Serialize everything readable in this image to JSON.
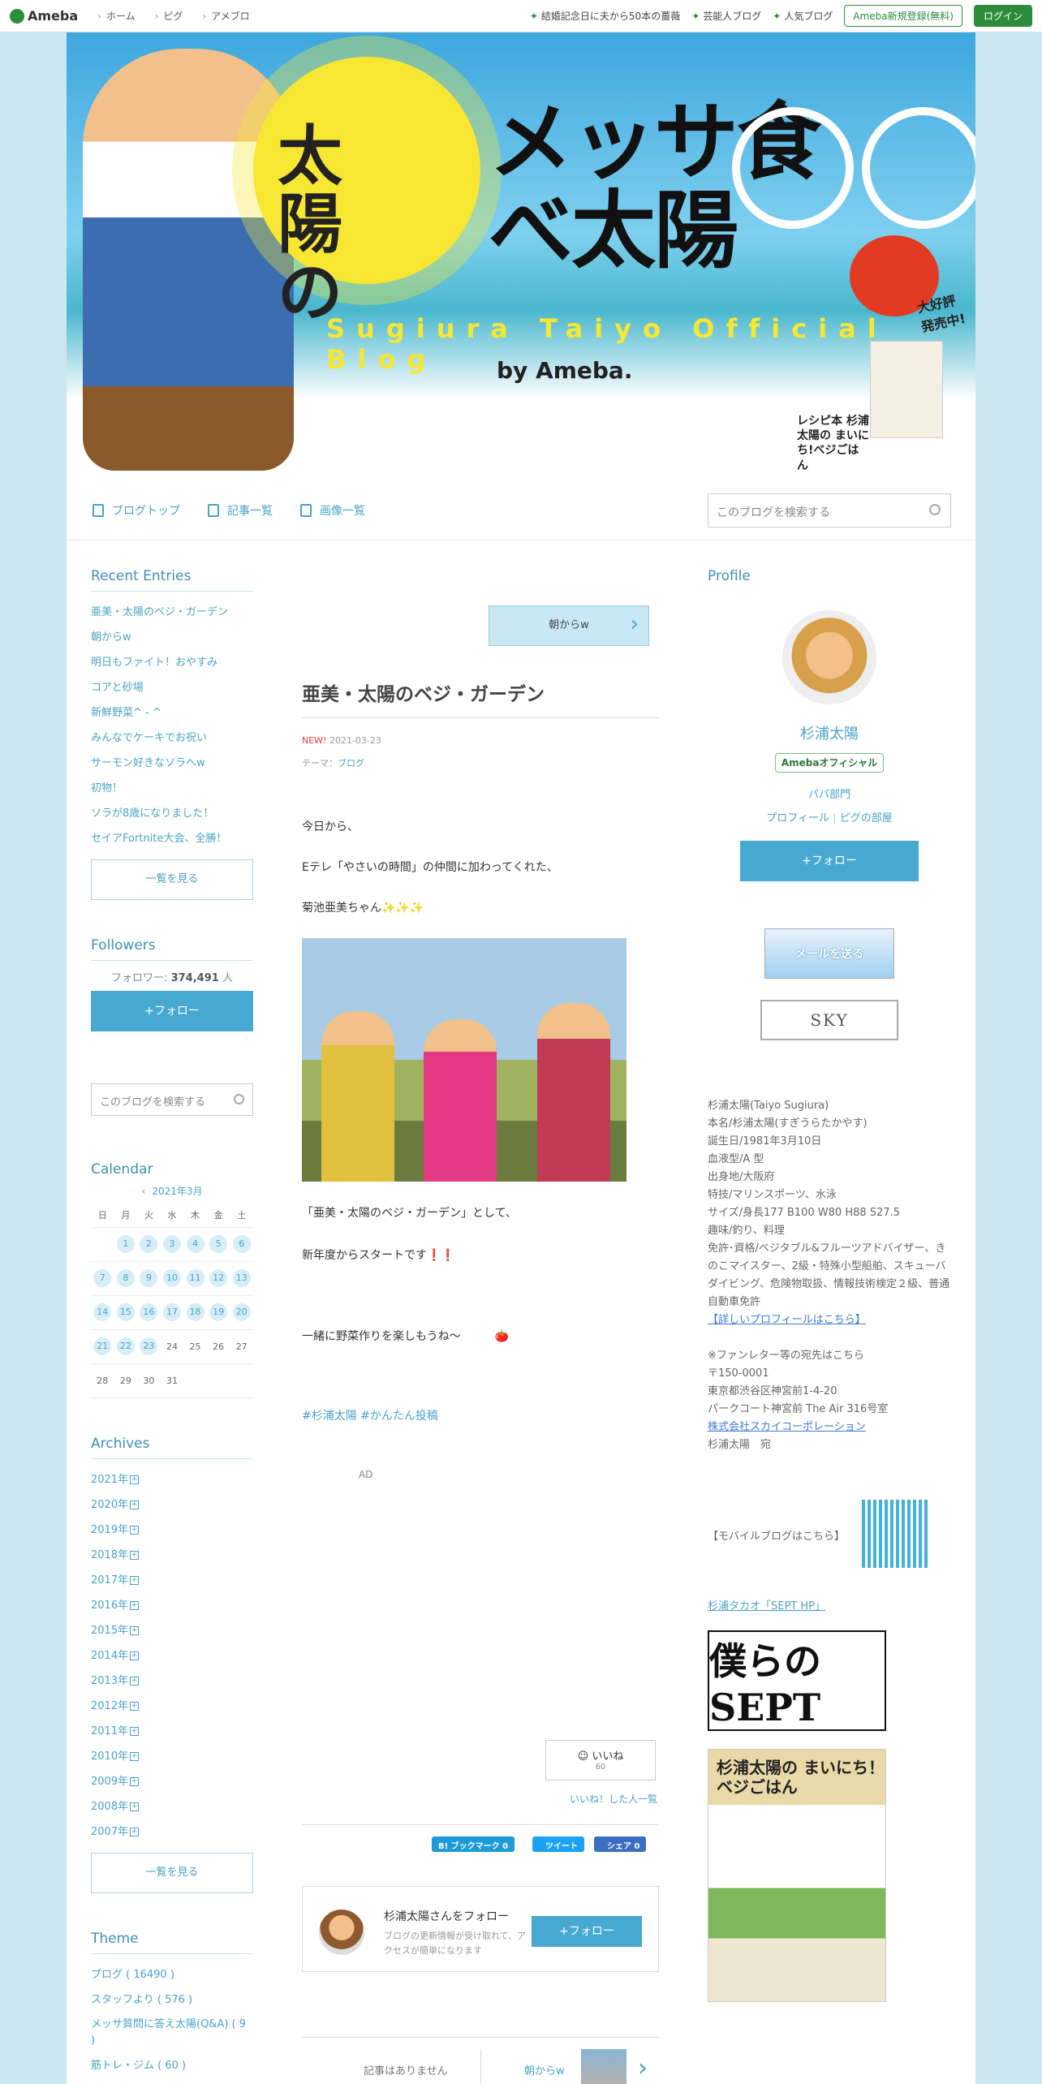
{
  "topbar": {
    "logo": "Ameba",
    "nav": [
      "ホーム",
      "ピグ",
      "アメブロ"
    ],
    "links": [
      "結婚記念日に夫から50本の薔薇",
      "芸能人ブログ",
      "人気ブログ"
    ],
    "register": "Ameba新規登録(無料)",
    "login": "ログイン"
  },
  "header": {
    "title_left": "太陽の",
    "title_right": "メッサ食べ太陽",
    "subtitle": "Sugiura Taiyo Official Blog",
    "by": "by Ameba.",
    "badge": "大好評発売中!",
    "recipe": "レシピ本 杉浦太陽の まいにち!べジごはん"
  },
  "blognav": {
    "items": [
      "ブログトップ",
      "記事一覧",
      "画像一覧"
    ],
    "search_placeholder": "このブログを検索する"
  },
  "left": {
    "recent_title": "Recent Entries",
    "recent": [
      "亜美・太陽のベジ・ガーデン",
      "朝からw",
      "明日もファイト！おやすみ",
      "コアと砂場",
      "新鮮野菜^ - ^",
      "みんなでケーキでお祝い",
      "サーモン好きなソラへw",
      "初物！",
      "ソラが8歳になりました！",
      "セイアFortnite大会、全勝！"
    ],
    "more": "一覧を見る",
    "followers_title": "Followers",
    "followers_label": "フォロワー:",
    "followers_count": "374,491",
    "followers_unit": "人",
    "follow": "+フォロー",
    "search_placeholder": "このブログを検索する",
    "calendar_title": "Calendar",
    "calendar_month": "2021年3月",
    "weekdays": [
      "日",
      "月",
      "火",
      "水",
      "木",
      "金",
      "土"
    ],
    "weeks": [
      [
        "",
        "1",
        "2",
        "3",
        "4",
        "5",
        "6"
      ],
      [
        "7",
        "8",
        "9",
        "10",
        "11",
        "12",
        "13"
      ],
      [
        "14",
        "15",
        "16",
        "17",
        "18",
        "19",
        "20"
      ],
      [
        "21",
        "22",
        "23",
        "24",
        "25",
        "26",
        "27"
      ],
      [
        "28",
        "29",
        "30",
        "31",
        "",
        "",
        ""
      ]
    ],
    "archives_title": "Archives",
    "archives": [
      "2021年",
      "2020年",
      "2019年",
      "2018年",
      "2017年",
      "2016年",
      "2015年",
      "2014年",
      "2013年",
      "2012年",
      "2011年",
      "2010年",
      "2009年",
      "2008年",
      "2007年"
    ],
    "archives_more": "一覧を見る",
    "theme_title": "Theme",
    "themes": [
      "ブログ ( 16490 )",
      "スタッフより ( 576 )",
      "メッサ質問に答え太陽(Q&A) ( 9 )",
      "筋トレ・ジム ( 60 )"
    ]
  },
  "main": {
    "next_button": "朝からw",
    "title": "亜美・太陽のベジ・ガーデン",
    "new": "NEW!",
    "date": "2021-03-23",
    "theme_label": "テーマ：",
    "theme": "ブログ",
    "p1": "今日から、",
    "p2": "Eテレ「やさいの時間」の仲間に加わってくれた、",
    "p3": "菊池亜美ちゃん✨✨✨",
    "p4": "「亜美・太陽のベジ・ガーデン」として、",
    "p5": "新年度からスタートです❗️❗️",
    "p6": "一緒に野菜作りを楽しもうね〜　　　🍅",
    "tags": "#杉浦太陽  #かんたん投稿",
    "ad": "AD",
    "iine": "いいね",
    "iine_count": "60",
    "iine_list": "いいね！した人一覧",
    "share_hatena": "B! ブックマーク  0",
    "share_tweet": "ツイート",
    "share_fb": "シェア 0",
    "follow_title": "杉浦太陽さんをフォロー",
    "follow_desc": "ブログの更新情報が受け取れて、アクセスが簡単になります",
    "follow_btn": "+フォロー",
    "prev": "記事はありません",
    "next": "朝からw"
  },
  "right": {
    "profile_title": "Profile",
    "name": "杉浦太陽",
    "official": "Amebaオフィシャル",
    "category": "パパ部門",
    "link_profile": "プロフィール",
    "link_room": "ピグの部屋",
    "follow": "+フォロー",
    "banner_mail": "メールを送る",
    "banner_sky": "SKY",
    "profile_lines": [
      "杉浦太陽(Taiyo Sugiura)",
      "本名/杉浦太陽(すぎうらたかやす)",
      "誕生日/1981年3月10日",
      "血液型/A 型",
      "出身地/大阪府",
      "特技/マリンスポーツ、水泳",
      "サイズ/身長177 B100 W80  H88 S27.5",
      "趣味/釣り、料理",
      "免許･資格/ベジタブル&フルーツアドバイザー、きのこマイスター、2級・特殊小型船舶、スキューバダイビング、危険物取扱、情報技術検定２級、普通自動車免許"
    ],
    "detail_link": "【詳しいプロフィールはこちら】",
    "fan_lines": [
      "※ファンレター等の宛先はこちら",
      "〒150-0001",
      "東京都渋谷区神宮前1-4-20",
      "パークコート神宮前 The Air 316号室"
    ],
    "company_link": "株式会社スカイコーポレーション",
    "addressee": "杉浦太陽　宛",
    "mobile": "【モバイルブログはこちら】",
    "sept_link": "杉浦タカオ「SEPT HP」",
    "sept_banner": "僕らのSEPT",
    "book_title": "杉浦太陽の まいにち！ベジごはん"
  }
}
